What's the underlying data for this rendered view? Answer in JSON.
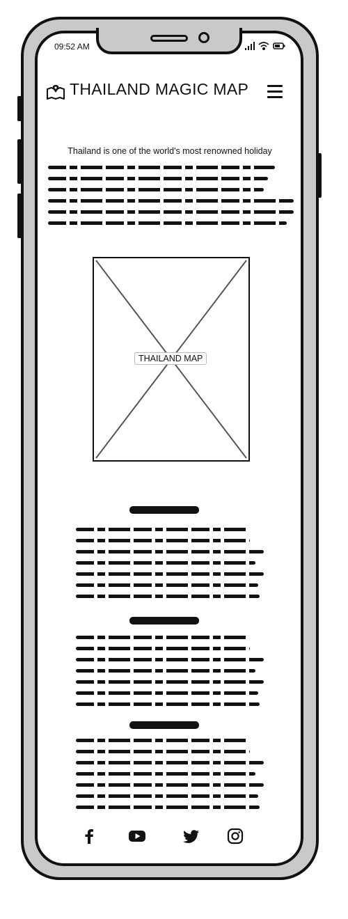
{
  "status_bar": {
    "time": "09:52 AM"
  },
  "header": {
    "title": "THAILAND MAGIC MAP",
    "logo_icon": "map-marker-icon",
    "menu_icon": "hamburger-menu-icon"
  },
  "intro": {
    "title": "Thailand is one of the world's most renowned holiday"
  },
  "map": {
    "label": "THAILAND MAP"
  },
  "footer": {
    "social_icons": [
      "facebook-icon",
      "youtube-icon",
      "twitter-icon",
      "instagram-icon"
    ]
  },
  "colors": {
    "frame": "#111111",
    "bezel": "#c9c9c9",
    "screen": "#ffffff"
  }
}
